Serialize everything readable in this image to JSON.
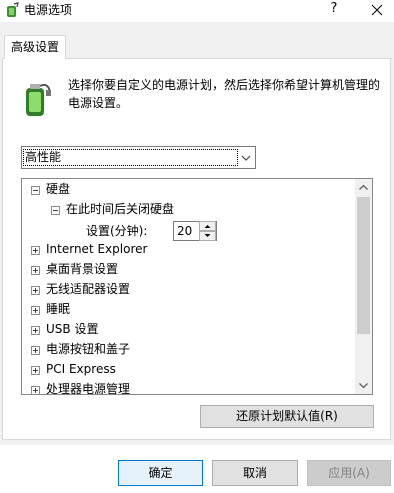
{
  "window": {
    "title": "电源选项",
    "help_label": "?",
    "close_label": "✕"
  },
  "tabs": [
    {
      "label": "高级设置"
    }
  ],
  "description": "选择你要自定义的电源计划，然后选择你希望计算机管理的电源设置。",
  "plan_select": {
    "value": "高性能"
  },
  "tree": {
    "hard_disk": {
      "label": "硬盘",
      "child_label": "在此时间后关闭硬盘",
      "setting_label": "设置(分钟):",
      "setting_value": "20"
    },
    "items": [
      {
        "label": "Internet Explorer"
      },
      {
        "label": "桌面背景设置"
      },
      {
        "label": "无线适配器设置"
      },
      {
        "label": "睡眠"
      },
      {
        "label": "USB 设置"
      },
      {
        "label": "电源按钮和盖子"
      },
      {
        "label": "PCI Express"
      },
      {
        "label": "处理器电源管理"
      }
    ]
  },
  "buttons": {
    "restore": "还原计划默认值(R)",
    "ok": "确定",
    "cancel": "取消",
    "apply": "应用(A)"
  }
}
